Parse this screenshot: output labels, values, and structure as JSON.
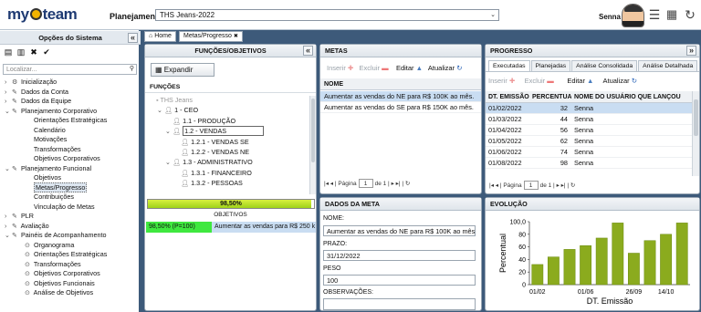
{
  "app": {
    "logo_prefix": "my",
    "logo_suffix": "team",
    "plan_label": "Planejamento:",
    "plan_value": "THS Jeans-2022",
    "user": "Senna"
  },
  "icons": {
    "menu": "hamburger-icon",
    "film": "film-icon",
    "refresh": "refresh-icon"
  },
  "left": {
    "title": "Opções do Sistema",
    "search_placeholder": "Localizar...",
    "items": [
      {
        "exp": "›",
        "icon": "⚙",
        "label": "Inicialização",
        "indent": 0
      },
      {
        "exp": "›",
        "icon": "✎",
        "label": "Dados da Conta",
        "indent": 0
      },
      {
        "exp": "›",
        "icon": "✎",
        "label": "Dados da Equipe",
        "indent": 0
      },
      {
        "exp": "⌄",
        "icon": "✎",
        "label": "Planejamento Corporativo",
        "indent": 0
      },
      {
        "exp": "",
        "icon": "",
        "label": "Orientações Estratégicas",
        "indent": 1
      },
      {
        "exp": "",
        "icon": "",
        "label": "Calendário",
        "indent": 1
      },
      {
        "exp": "",
        "icon": "",
        "label": "Motivações",
        "indent": 1
      },
      {
        "exp": "",
        "icon": "",
        "label": "Transformações",
        "indent": 1
      },
      {
        "exp": "",
        "icon": "",
        "label": "Objetivos Corporativos",
        "indent": 1
      },
      {
        "exp": "⌄",
        "icon": "✎",
        "label": "Planejamento Funcional",
        "indent": 0
      },
      {
        "exp": "",
        "icon": "",
        "label": "Objetivos",
        "indent": 1
      },
      {
        "exp": "",
        "icon": "",
        "label": "Metas/Progresso",
        "indent": 1,
        "selected": true
      },
      {
        "exp": "",
        "icon": "",
        "label": "Contribuições",
        "indent": 1
      },
      {
        "exp": "",
        "icon": "",
        "label": "Vinculação de Metas",
        "indent": 1
      },
      {
        "exp": "›",
        "icon": "✎",
        "label": "PLR",
        "indent": 0
      },
      {
        "exp": "›",
        "icon": "✎",
        "label": "Avaliação",
        "indent": 0
      },
      {
        "exp": "⌄",
        "icon": "✎",
        "label": "Painéis de Acompanhamento",
        "indent": 0
      },
      {
        "exp": "",
        "icon": "⊙",
        "label": "Organograma",
        "indent": 1
      },
      {
        "exp": "",
        "icon": "⊙",
        "label": "Orientações Estratégicas",
        "indent": 1
      },
      {
        "exp": "",
        "icon": "⊙",
        "label": "Transformações",
        "indent": 1
      },
      {
        "exp": "",
        "icon": "⊙",
        "label": "Objetivos Corporativos",
        "indent": 1
      },
      {
        "exp": "",
        "icon": "⊙",
        "label": "Objetivos Funcionais",
        "indent": 1
      },
      {
        "exp": "",
        "icon": "⊙",
        "label": "Análise de Objetivos",
        "indent": 1
      }
    ]
  },
  "tabs": {
    "home": "Home",
    "metas": "Metas/Progresso"
  },
  "funcoes": {
    "title": "FUNÇÕES/OBJETIVOS",
    "expand": "Expandir",
    "section": "FUNÇÕES",
    "tree": [
      {
        "label": "THS Jeans",
        "indent": 0,
        "exp": "",
        "muted": true
      },
      {
        "label": "1 - CEO",
        "indent": 1,
        "exp": "⌄"
      },
      {
        "label": "1.1 - PRODUÇÃO",
        "indent": 2,
        "exp": ""
      },
      {
        "label": "1.2 - VENDAS",
        "indent": 2,
        "exp": "⌄",
        "selected": true
      },
      {
        "label": "1.2.1 - VENDAS SE",
        "indent": 3,
        "exp": ""
      },
      {
        "label": "1.2.2 - VENDAS NE",
        "indent": 3,
        "exp": ""
      },
      {
        "label": "1.3 - ADMINISTRATIVO",
        "indent": 2,
        "exp": "⌄"
      },
      {
        "label": "1.3.1 - FINANCEIRO",
        "indent": 3,
        "exp": ""
      },
      {
        "label": "1.3.2 - PESSOAS",
        "indent": 3,
        "exp": ""
      }
    ],
    "progress_label": "98,50%",
    "progress": 0.985,
    "objetivos_title": "OBJETIVOS",
    "obj_status": "98,50% (P=100)",
    "obj_text": "Aumentar as vendas para R$ 250 k"
  },
  "metas": {
    "title": "METAS",
    "insert": "Inserir",
    "delete": "Excluir",
    "edit": "Editar",
    "update": "Atualizar",
    "col": "NOME",
    "rows": [
      "Aumentar as vendas do NE para R$ 100K ao mês.",
      "Aumentar as vendas do SE para R$ 150K ao mês."
    ],
    "page_label": "Página",
    "page": "1",
    "of": "de 1"
  },
  "dados": {
    "title": "DADOS DA META",
    "nome_label": "NOME:",
    "nome": "Aumentar as vendas do NE para R$ 100K ao mês.",
    "prazo_label": "PRAZO:",
    "prazo": "31/12/2022",
    "peso_label": "PESO",
    "peso": "100",
    "obs_label": "OBSERVAÇÕES:"
  },
  "progresso": {
    "title": "PROGRESSO",
    "tabs": [
      "Executadas",
      "Planejadas",
      "Análise Consolidada",
      "Análise Detalhada"
    ],
    "insert": "Inserir",
    "delete": "Excluir",
    "edit": "Editar",
    "update": "Atualizar",
    "cols": [
      "DT. EMISSÃO",
      "PERCENTUAL",
      "NOME DO USUÁRIO QUE LANÇOU"
    ],
    "rows": [
      [
        "01/02/2022",
        "32",
        "Senna"
      ],
      [
        "01/03/2022",
        "44",
        "Senna"
      ],
      [
        "01/04/2022",
        "56",
        "Senna"
      ],
      [
        "01/05/2022",
        "62",
        "Senna"
      ],
      [
        "01/06/2022",
        "74",
        "Senna"
      ],
      [
        "01/08/2022",
        "98",
        "Senna"
      ]
    ],
    "page_label": "Página",
    "page": "1",
    "of": "de 1"
  },
  "evolucao": {
    "title": "EVOLUÇÃO"
  },
  "chart_data": {
    "type": "bar",
    "xlabel": "DT. Emissão",
    "ylabel": "Percentual",
    "ylim": [
      0,
      100
    ],
    "yticks": [
      "0",
      "20",
      "40",
      "60",
      "80",
      "100,0"
    ],
    "xticks": [
      "01/02",
      "01/06",
      "26/09",
      "14/10"
    ],
    "values": [
      32,
      44,
      56,
      62,
      74,
      98,
      50,
      70,
      80,
      98
    ],
    "color": "#8bab1e"
  }
}
